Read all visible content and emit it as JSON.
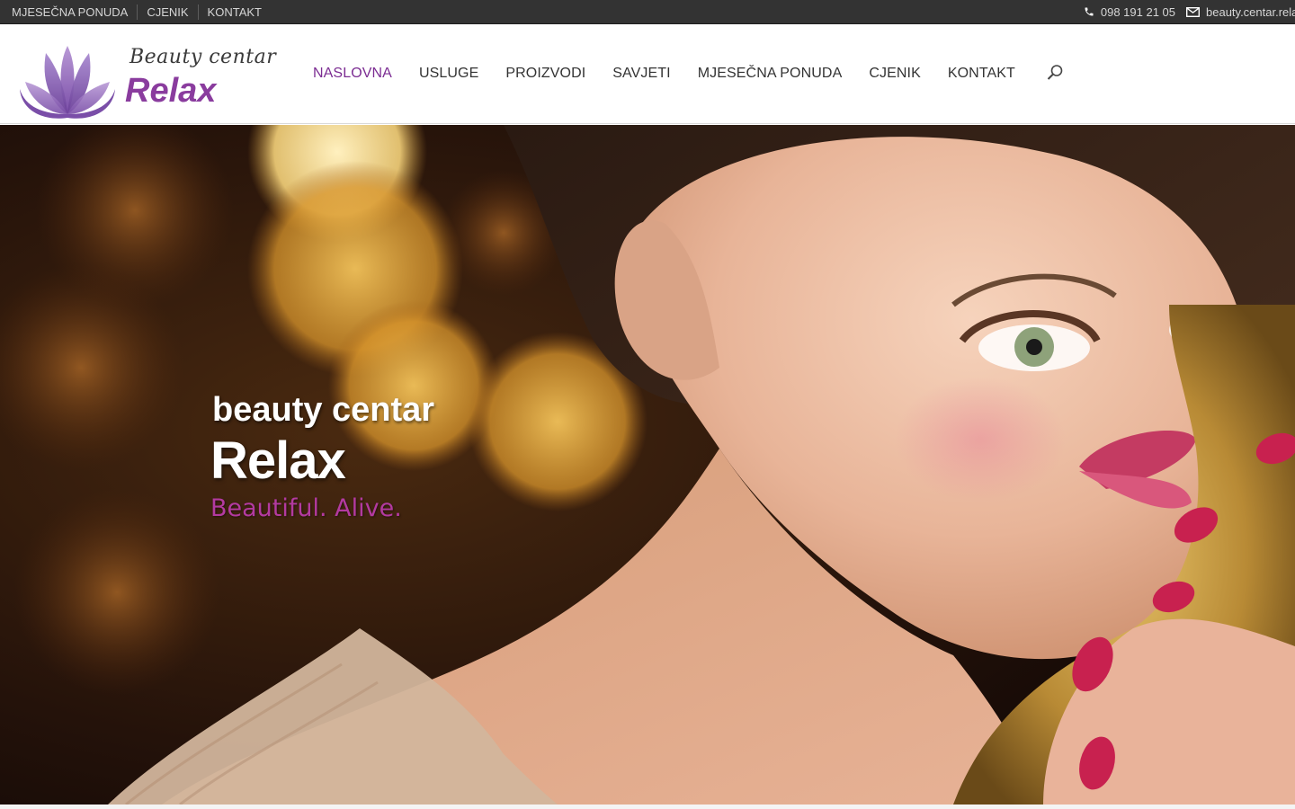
{
  "topbar": {
    "links": [
      "MJESEČNA PONUDA",
      "CJENIK",
      "KONTAKT"
    ],
    "phone": "098 191 21 05",
    "email": "beauty.centar.rela"
  },
  "logo": {
    "script_text": "Beauty centar",
    "name": "Relax"
  },
  "nav": {
    "items": [
      "NASLOVNA",
      "USLUGE",
      "PROIZVODI",
      "SAVJETI",
      "MJESEČNA PONUDA",
      "CJENIK",
      "KONTAKT"
    ],
    "active_index": 0,
    "search_icon": "search-icon"
  },
  "hero": {
    "line1": "beauty centar",
    "line2": "Relax",
    "line3": "Beautiful. Alive.",
    "image": "woman-portrait-bokeh"
  },
  "colors": {
    "accent": "#7b2c92",
    "logo_purple": "#8a3c9e",
    "tagline_pink": "#b33aa0",
    "topbar_bg": "#333333"
  }
}
